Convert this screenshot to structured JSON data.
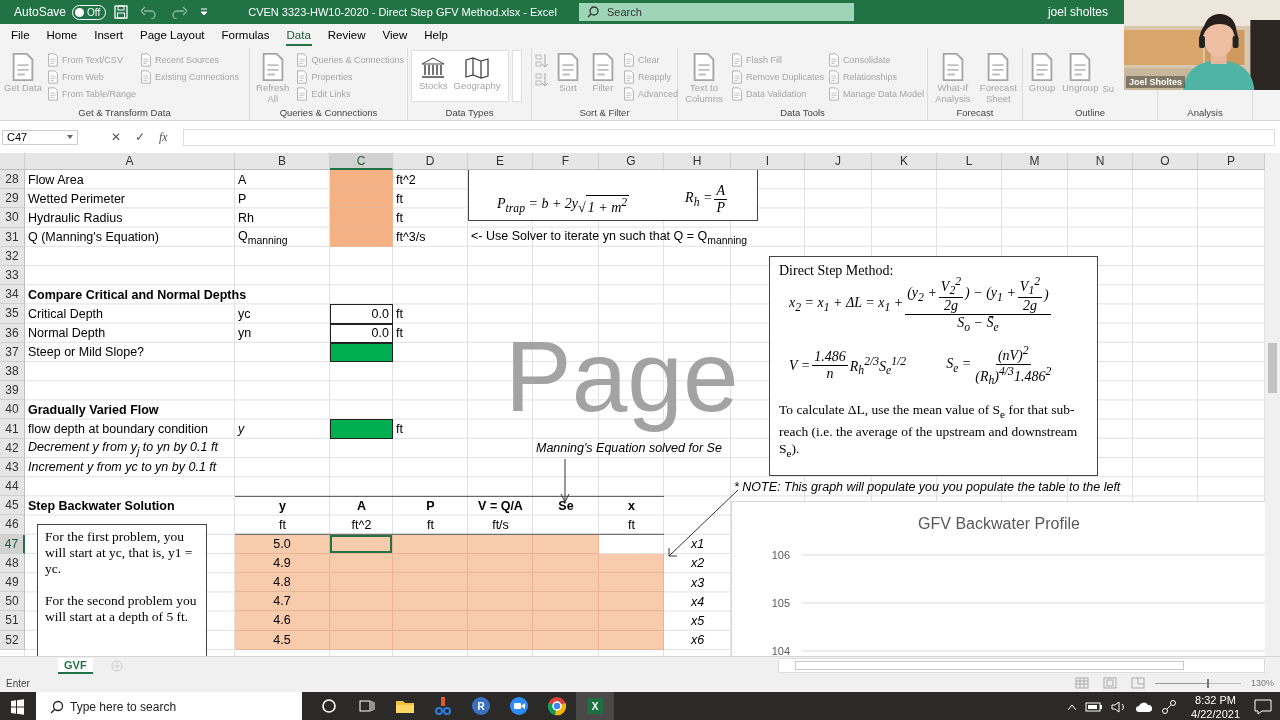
{
  "title_bar": {
    "autosave": {
      "label": "AutoSave",
      "state": "Off",
      "on": false
    },
    "title": "CVEN 3323-HW10-2020 - Direct Step GFV Method.xlsx  -  Excel",
    "search": {
      "placeholder": "Search"
    },
    "user": "joel sholtes"
  },
  "webcam": {
    "kind": "picture",
    "label": "Joel Sholtes"
  },
  "tabs": [
    {
      "label": "File",
      "selected": false
    },
    {
      "label": "Home",
      "selected": false
    },
    {
      "label": "Insert",
      "selected": false
    },
    {
      "label": "Page Layout",
      "selected": false
    },
    {
      "label": "Formulas",
      "selected": false
    },
    {
      "label": "Data",
      "selected": true
    },
    {
      "label": "Review",
      "selected": false
    },
    {
      "label": "View",
      "selected": false
    },
    {
      "label": "Help",
      "selected": false
    }
  ],
  "ribbon": [
    {
      "label": "Get & Transform Data",
      "kind": "plain",
      "items": [
        {
          "kind": "large",
          "label": "Get Data",
          "disabled": true
        },
        {
          "kind": "small",
          "label": "From Text/CSV",
          "disabled": true
        },
        {
          "kind": "small",
          "label": "From Web",
          "disabled": true
        },
        {
          "kind": "small",
          "label": "From Table/Range",
          "disabled": true
        },
        {
          "kind": "small2",
          "label": "Recent Sources",
          "disabled": true
        },
        {
          "kind": "small2",
          "label": "Existing Connections",
          "disabled": true
        }
      ]
    },
    {
      "label": "Queries & Connections",
      "kind": "plain",
      "items": [
        {
          "kind": "large",
          "label": "Refresh All",
          "disabled": true
        },
        {
          "kind": "small",
          "label": "Queries & Connections",
          "disabled": true
        },
        {
          "kind": "small",
          "label": "Properties",
          "disabled": true
        },
        {
          "kind": "small",
          "label": "Edit Links",
          "disabled": true
        }
      ]
    },
    {
      "label": "Data Types",
      "kind": "gallery",
      "items": [
        {
          "kind": "large",
          "label": "Stocks",
          "disabled": true
        },
        {
          "kind": "large",
          "label": "Geography",
          "disabled": true
        }
      ]
    },
    {
      "label": "Sort & Filter",
      "kind": "plain",
      "items": [
        {
          "kind": "sort",
          "disabled": true
        },
        {
          "kind": "sort",
          "disabled": true
        },
        {
          "kind": "large",
          "label": "Sort",
          "disabled": true
        },
        {
          "kind": "large",
          "label": "Filter",
          "disabled": true
        },
        {
          "kind": "small",
          "label": "Clear",
          "disabled": true
        },
        {
          "kind": "small",
          "label": "Reapply",
          "disabled": true
        },
        {
          "kind": "small",
          "label": "Advanced",
          "disabled": true
        }
      ]
    },
    {
      "label": "Data Tools",
      "kind": "plain",
      "items": [
        {
          "kind": "large",
          "label": "Text to Columns",
          "disabled": true
        },
        {
          "kind": "small",
          "label": "Flash Fill",
          "disabled": true
        },
        {
          "kind": "small",
          "label": "Remove Duplicates",
          "disabled": true
        },
        {
          "kind": "small",
          "label": "Data Validation",
          "disabled": true
        },
        {
          "kind": "small2",
          "label": "Consolidate",
          "disabled": true
        },
        {
          "kind": "small2",
          "label": "Relationships",
          "disabled": true
        },
        {
          "kind": "small2",
          "label": "Manage Data Model",
          "disabled": true
        }
      ]
    },
    {
      "label": "Forecast",
      "kind": "plain",
      "items": [
        {
          "kind": "large",
          "label": "What-If Analysis",
          "disabled": true
        },
        {
          "kind": "large",
          "label": "Forecast Sheet",
          "disabled": true
        }
      ]
    },
    {
      "label": "Outline",
      "kind": "plain",
      "items": [
        {
          "kind": "large",
          "label": "Group",
          "disabled": true
        },
        {
          "kind": "large",
          "label": "Ungroup",
          "disabled": true
        },
        {
          "kind": "cut",
          "label": "Su",
          "disabled": true
        }
      ]
    },
    {
      "label": "Analysis",
      "kind": "plain"
    }
  ],
  "formula_bar": {
    "name_box": "C47",
    "buttons": [
      "✕",
      "✓",
      "fx"
    ]
  },
  "columns": [
    {
      "label": "A",
      "selected": false
    },
    {
      "label": "B",
      "selected": false
    },
    {
      "label": "C",
      "selected": true
    },
    {
      "label": "D",
      "selected": false
    },
    {
      "label": "E",
      "selected": false
    },
    {
      "label": "F",
      "selected": false
    },
    {
      "label": "G",
      "selected": false
    },
    {
      "label": "H",
      "selected": false
    },
    {
      "label": "I",
      "selected": false
    },
    {
      "label": "J",
      "selected": false
    },
    {
      "label": "K",
      "selected": false
    },
    {
      "label": "L",
      "selected": false
    },
    {
      "label": "M",
      "selected": false
    },
    {
      "label": "N",
      "selected": false
    },
    {
      "label": "O",
      "selected": false
    },
    {
      "label": "P",
      "selected": false
    }
  ],
  "rows": [
    {
      "num": "28",
      "selected": false,
      "cells": {
        "A": {
          "text": "Flow Area"
        },
        "B": {
          "text": "A"
        },
        "C": {
          "color": "#f4b183"
        },
        "D": {
          "text": "ft^2"
        }
      }
    },
    {
      "num": "29",
      "selected": false,
      "cells": {
        "A": {
          "text": "Wetted Perimeter"
        },
        "B": {
          "text": "P"
        },
        "C": {
          "color": "#f4b183"
        },
        "D": {
          "text": "ft"
        }
      }
    },
    {
      "num": "30",
      "selected": false,
      "cells": {
        "A": {
          "text": "Hydraulic Radius"
        },
        "B": {
          "text": "Rh"
        },
        "C": {
          "color": "#f4b183"
        },
        "D": {
          "text": "ft"
        }
      }
    },
    {
      "num": "31",
      "selected": false,
      "cells": {
        "A": {
          "text": "Q (Manning's Equation)"
        },
        "B": {
          "text": "Q$_{manning}$"
        },
        "C": {
          "color": "#f4b183"
        },
        "D": {
          "text": "ft^3/s"
        },
        "E": {
          "text": "<- Use Solver to iterate yn such that Q = Q$_{manning}$"
        }
      }
    },
    {
      "num": "32",
      "selected": false
    },
    {
      "num": "33",
      "selected": false
    },
    {
      "num": "34",
      "selected": false,
      "cells": {
        "A": {
          "text": "Compare Critical and Normal Depths",
          "kind": "bold"
        }
      }
    },
    {
      "num": "35",
      "selected": false,
      "cells": {
        "A": {
          "text": "Critical Depth"
        },
        "B": {
          "text": "yc"
        },
        "C": {
          "text": "0.0",
          "kind": "right",
          "bordered": true
        },
        "D": {
          "text": "ft"
        }
      }
    },
    {
      "num": "36",
      "selected": false,
      "cells": {
        "A": {
          "text": "Normal Depth"
        },
        "B": {
          "text": "yn"
        },
        "C": {
          "text": "0.0",
          "kind": "right",
          "bordered": true
        },
        "D": {
          "text": "ft"
        }
      }
    },
    {
      "num": "37",
      "selected": false,
      "cells": {
        "A": {
          "text": "Steep or Mild Slope?"
        },
        "C": {
          "color": "#00b050",
          "bordered": true
        }
      }
    },
    {
      "num": "38",
      "selected": false
    },
    {
      "num": "39",
      "selected": false
    },
    {
      "num": "40",
      "selected": false,
      "cells": {
        "A": {
          "text": "Gradually Varied Flow",
          "kind": "bold"
        }
      }
    },
    {
      "num": "41",
      "selected": false,
      "cells": {
        "A": {
          "text": "flow depth at boundary condition"
        },
        "B": {
          "text": "y",
          "kind": "italic"
        },
        "C": {
          "color": "#00b050",
          "bordered": true
        },
        "D": {
          "text": "ft"
        }
      }
    },
    {
      "num": "42",
      "selected": false,
      "cells": {
        "A": {
          "text": "Decrement y from y$_{j}$ to yn by 0.1 ft",
          "kind": "italic"
        },
        "F": {
          "text": "Manning's Equation solved for Se",
          "kind": "italic"
        }
      }
    },
    {
      "num": "43",
      "selected": false,
      "cells": {
        "A": {
          "text": "Increment y from yc to yn by 0.1 ft",
          "kind": "italic"
        }
      }
    },
    {
      "num": "44",
      "selected": false,
      "cells": {
        "I": {
          "text": "* NOTE: This graph will populate you you populate the table to the left",
          "kind": "italic"
        }
      }
    },
    {
      "num": "45",
      "selected": false,
      "cells": {
        "A": {
          "text": "Step Backwater Solution",
          "kind": "bold"
        },
        "B": {
          "text": "y",
          "kind": "header"
        },
        "C": {
          "text": "A",
          "kind": "header"
        },
        "D": {
          "text": "P",
          "kind": "header"
        },
        "E": {
          "text": "V = Q/A",
          "kind": "header"
        },
        "F": {
          "text": "Se",
          "kind": "header"
        },
        "G": {
          "text": "x",
          "kind": "header"
        }
      }
    },
    {
      "num": "46",
      "selected": false,
      "cells": {
        "B": {
          "text": "ft",
          "kind": "unit"
        },
        "C": {
          "text": "ft^2",
          "kind": "unit"
        },
        "D": {
          "text": "ft",
          "kind": "unit"
        },
        "E": {
          "text": "ft/s",
          "kind": "unit"
        },
        "F": {
          "kind": "unit"
        },
        "G": {
          "text": "ft",
          "kind": "unit"
        }
      }
    },
    {
      "num": "47",
      "selected": true,
      "cells": {
        "B": {
          "text": "5.0",
          "kind": "center",
          "color": "#f8cbad"
        },
        "C": {
          "color": "#f8cbad",
          "selected": true
        },
        "D": {
          "color": "#f8cbad"
        },
        "E": {
          "color": "#f8cbad"
        },
        "F": {
          "color": "#f8cbad"
        },
        "H": {
          "text": "x1",
          "kind": "italic-center"
        }
      }
    },
    {
      "num": "48",
      "selected": false,
      "cells": {
        "B": {
          "text": "4.9",
          "kind": "center",
          "color": "#f8cbad"
        },
        "C": {
          "color": "#f8cbad"
        },
        "D": {
          "color": "#f8cbad"
        },
        "E": {
          "color": "#f8cbad"
        },
        "F": {
          "color": "#f8cbad"
        },
        "G": {
          "color": "#f8cbad"
        },
        "H": {
          "text": "x2",
          "kind": "italic-center"
        }
      }
    },
    {
      "num": "49",
      "selected": false,
      "cells": {
        "B": {
          "text": "4.8",
          "kind": "center",
          "color": "#f8cbad"
        },
        "C": {
          "color": "#f8cbad"
        },
        "D": {
          "color": "#f8cbad"
        },
        "E": {
          "color": "#f8cbad"
        },
        "F": {
          "color": "#f8cbad"
        },
        "G": {
          "color": "#f8cbad"
        },
        "H": {
          "text": "x3",
          "kind": "italic-center"
        }
      }
    },
    {
      "num": "50",
      "selected": false,
      "cells": {
        "B": {
          "text": "4.7",
          "kind": "center",
          "color": "#f8cbad"
        },
        "C": {
          "color": "#f8cbad"
        },
        "D": {
          "color": "#f8cbad"
        },
        "E": {
          "color": "#f8cbad"
        },
        "F": {
          "color": "#f8cbad"
        },
        "G": {
          "color": "#f8cbad"
        },
        "H": {
          "text": "x4",
          "kind": "italic-center"
        }
      }
    },
    {
      "num": "51",
      "selected": false,
      "cells": {
        "B": {
          "text": "4.6",
          "kind": "center",
          "color": "#f8cbad"
        },
        "C": {
          "color": "#f8cbad"
        },
        "D": {
          "color": "#f8cbad"
        },
        "E": {
          "color": "#f8cbad"
        },
        "F": {
          "color": "#f8cbad"
        },
        "G": {
          "color": "#f8cbad"
        },
        "H": {
          "text": "x5",
          "kind": "italic-center"
        }
      }
    },
    {
      "num": "52",
      "selected": false,
      "cells": {
        "B": {
          "text": "4.5",
          "kind": "center",
          "color": "#f8cbad"
        },
        "C": {
          "color": "#f8cbad"
        },
        "D": {
          "color": "#f8cbad"
        },
        "E": {
          "color": "#f8cbad"
        },
        "F": {
          "color": "#f8cbad"
        },
        "G": {
          "color": "#f8cbad"
        },
        "H": {
          "text": "x6",
          "kind": "italic-center"
        }
      }
    }
  ],
  "page_label": "Page",
  "geometry_box": {
    "equations": [
      [
        {
          "kind": "text",
          "text": "P$_{trap}$ = b + 2y"
        },
        {
          "kind": "sqrt",
          "sign": "√",
          "body": "1 + m$^{2}$"
        }
      ],
      [
        {
          "kind": "text",
          "text": "R$_{h}$ = "
        },
        {
          "kind": "frac",
          "num": [
            {
              "kind": "text",
              "text": "A"
            }
          ],
          "den": [
            {
              "kind": "text",
              "text": "P"
            }
          ]
        }
      ]
    ]
  },
  "direct_step_box": {
    "heading": "Direct Step Method:",
    "equations": [
      [
        {
          "kind": "text",
          "text": "x$_{2}$ = x$_{1}$ + ΔL = x$_{1}$ + "
        },
        {
          "kind": "frac",
          "num": [
            {
              "kind": "text",
              "text": "(y$_{2}$ + "
            },
            {
              "kind": "frac",
              "num": [
                {
                  "kind": "text",
                  "text": "V$_{2}$$^{2}$"
                }
              ],
              "den": [
                {
                  "kind": "text",
                  "text": "2g"
                }
              ]
            },
            {
              "kind": "text",
              "text": ") − (y$_{1}$ + "
            },
            {
              "kind": "frac",
              "num": [
                {
                  "kind": "text",
                  "text": "V$_{1}$$^{2}$"
                }
              ],
              "den": [
                {
                  "kind": "text",
                  "text": "2g"
                }
              ]
            },
            {
              "kind": "text",
              "text": ")"
            }
          ],
          "den": [
            {
              "kind": "text",
              "text": "S$_{o}$ − S̄$_{e}$"
            }
          ]
        }
      ],
      [
        {
          "kind": "text",
          "text": "V = "
        },
        {
          "kind": "frac",
          "num": [
            {
              "kind": "text",
              "text": "1.486"
            }
          ],
          "den": [
            {
              "kind": "text",
              "text": "n"
            }
          ]
        },
        {
          "kind": "text",
          "text": " R$_{h}$$^{2/3}$S$_{e}$$^{1/2}$"
        }
      ],
      [
        {
          "kind": "text",
          "text": "S$_{e}$ = "
        },
        {
          "kind": "frac",
          "num": [
            {
              "kind": "text",
              "text": "(nV)$^{2}$"
            }
          ],
          "den": [
            {
              "kind": "text",
              "text": "(R$_{h}$)$^{4/3}$1.486$^{2}$"
            }
          ]
        }
      ]
    ],
    "note": "To calculate ΔL, use the mean value of S$_{e}$ for that sub-reach (i.e. the average of the upstream and downstream S$_{e}$)."
  },
  "start_box": {
    "paragraphs": [
      "For the first problem, you will start at yc, that is, y1 = yc.",
      "For the second problem you will start at a depth of 5 ft."
    ]
  },
  "chart": {
    "title": "GFV Backwater Profile",
    "axis_labels": [
      "106",
      "105",
      "104"
    ]
  },
  "sheet_tabs": [
    {
      "label": "GVF",
      "selected": true
    }
  ],
  "status_bar": {
    "mode": "Enter",
    "zoom": {
      "label": "130%",
      "level": 0.6
    }
  },
  "taskbar": {
    "search": {
      "placeholder": "Type here to search"
    },
    "apps": [
      {
        "kind": "cortana",
        "selected": false
      },
      {
        "kind": "taskview",
        "selected": false
      },
      {
        "kind": "explorer",
        "selected": false
      },
      {
        "kind": "snip",
        "selected": false
      },
      {
        "kind": "r",
        "label": "R",
        "selected": false
      },
      {
        "kind": "zoom",
        "selected": false
      },
      {
        "kind": "chrome",
        "selected": false
      },
      {
        "kind": "excel",
        "label": "X",
        "selected": true
      }
    ],
    "time": "8:32 PM",
    "date": "4/22/2021"
  }
}
